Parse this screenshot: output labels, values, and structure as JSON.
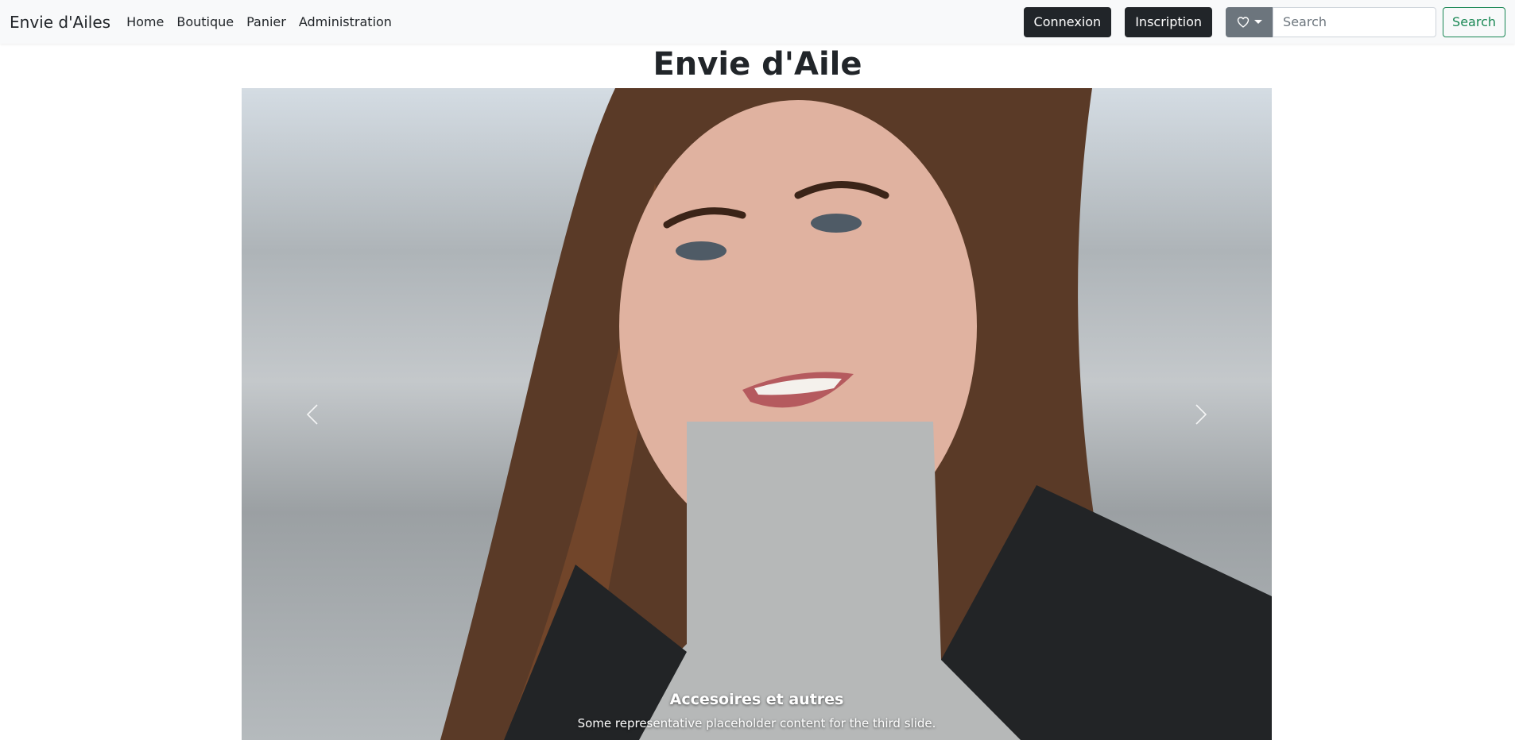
{
  "navbar": {
    "brand": "Envie d'Ailes",
    "links": [
      "Home",
      "Boutique",
      "Panier",
      "Administration"
    ],
    "login_label": "Connexion",
    "signup_label": "Inscription",
    "favorites_icon": "heart-icon",
    "search_placeholder": "Search",
    "search_button": "Search"
  },
  "page": {
    "title": "Envie d'Aile"
  },
  "carousel": {
    "caption_title": "Accesoires et autres",
    "caption_text": "Some representative placeholder content for the third slide."
  },
  "colors": {
    "navbar_bg": "#f8f9fa",
    "dark_button": "#212529",
    "secondary_button": "#6c757d",
    "success_outline": "#198754"
  }
}
